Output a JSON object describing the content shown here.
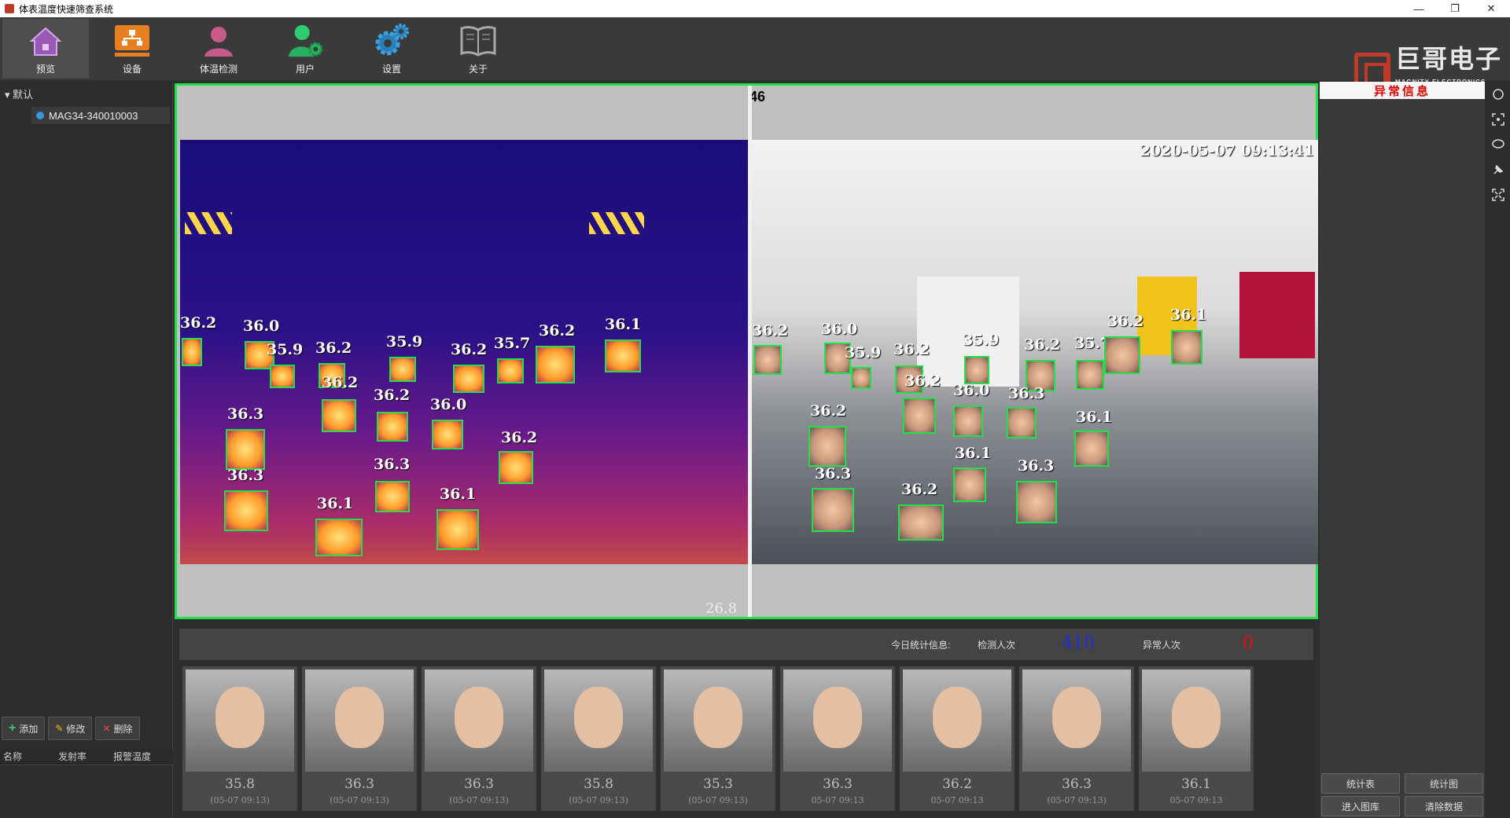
{
  "window": {
    "title": "体表温度快速筛查系统",
    "controls": [
      "minimize-icon",
      "restore-icon",
      "close-icon"
    ]
  },
  "toolbar": {
    "items": [
      {
        "label": "预览",
        "icon": "home-icon",
        "active": true
      },
      {
        "label": "设备",
        "icon": "device-icon",
        "active": false
      },
      {
        "label": "体温检测",
        "icon": "person-thermal-icon",
        "active": false
      },
      {
        "label": "用户",
        "icon": "user-gear-icon",
        "active": false
      },
      {
        "label": "设置",
        "icon": "gears-icon",
        "active": false
      },
      {
        "label": "关于",
        "icon": "book-icon",
        "active": false
      }
    ],
    "brand": {
      "name": "巨哥电子",
      "sub": "MAGNITY ELECTRONICS"
    }
  },
  "tree": {
    "root": "默认",
    "device": "MAG34-340010003"
  },
  "left_actions": {
    "add": "添加",
    "edit": "修改",
    "delete": "删除"
  },
  "left_table_headers": [
    "名称",
    "发射率",
    "报警温度"
  ],
  "video": {
    "count": "46",
    "timestamp": "2020-05-07 09:13:41",
    "ambient": "26.8",
    "ir_temps": [
      "36.2",
      "36.0",
      "35.9",
      "36.2",
      "35.9",
      "36.2",
      "35.7",
      "36.2",
      "36.1",
      "36.2",
      "36.2",
      "36.0",
      "36.3",
      "36.2",
      "36.3",
      "36.3",
      "36.1",
      "36.1"
    ],
    "rgb_temps": [
      "36.2",
      "36.0",
      "35.9",
      "36.2",
      "35.9",
      "36.2",
      "35.7",
      "36.2",
      "36.1",
      "36.2",
      "36.0",
      "36.3",
      "36.2",
      "36.1",
      "36.1",
      "36.3",
      "36.3",
      "36.2"
    ]
  },
  "stats": {
    "today_label": "今日统计信息:",
    "detected_label": "检测人次",
    "detected_value": "410",
    "abnormal_label": "异常人次",
    "abnormal_value": "0",
    "detected_color": "#1e2fd6",
    "abnormal_color": "#e01010"
  },
  "thumbnails": [
    {
      "temp": "35.8",
      "time": "(05-07 09:13)"
    },
    {
      "temp": "36.3",
      "time": "(05-07 09:13)"
    },
    {
      "temp": "36.3",
      "time": "(05-07 09:13)"
    },
    {
      "temp": "35.8",
      "time": "(05-07 09:13)"
    },
    {
      "temp": "35.3",
      "time": "(05-07 09:13)"
    },
    {
      "temp": "36.3",
      "time": "05-07 09:13"
    },
    {
      "temp": "36.2",
      "time": "05-07 09:13"
    },
    {
      "temp": "36.3",
      "time": "(05-07 09:13)"
    },
    {
      "temp": "36.1",
      "time": "05-07 09:13"
    }
  ],
  "right_panel": {
    "title": "异常信息",
    "buttons": [
      "统计表",
      "统计图",
      "进入图库",
      "清除数据"
    ]
  },
  "side_tools": [
    "record-icon",
    "capture-icon",
    "chat-icon",
    "pin-icon",
    "fullscreen-icon"
  ]
}
